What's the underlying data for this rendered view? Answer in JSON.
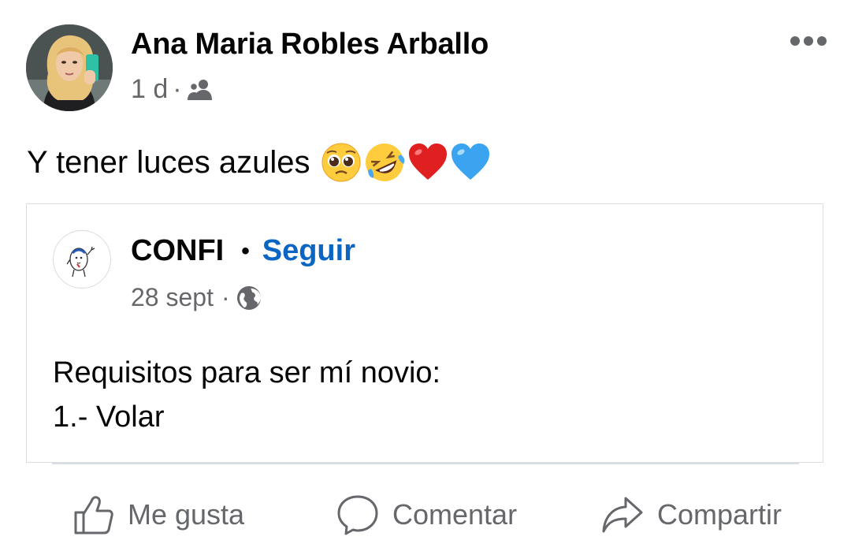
{
  "post": {
    "author": "Ana Maria Robles Arballo",
    "time": "1 d",
    "separator": "·",
    "audience_icon": "friends-icon",
    "more_icon": "more-horizontal-icon",
    "text": "Y tener luces azules",
    "emojis": [
      "pleading-face-emoji",
      "rolling-on-floor-laughing-emoji",
      "red-heart-emoji",
      "blue-heart-emoji"
    ]
  },
  "shared_post": {
    "page_name": "CONFI",
    "name_separator": "•",
    "follow_label": "Seguir",
    "time": "28 sept",
    "separator": "·",
    "audience_icon": "globe-icon",
    "lines": [
      "Requisitos para ser mí novio:",
      "1.- Volar"
    ]
  },
  "actions": {
    "like": "Me gusta",
    "comment": "Comentar",
    "share": "Compartir"
  },
  "colors": {
    "text": "#050505",
    "secondary": "#65676b",
    "link": "#0a66c2",
    "border": "#dadde1",
    "red_heart": "#e02020",
    "blue_heart": "#3aa4f0"
  }
}
